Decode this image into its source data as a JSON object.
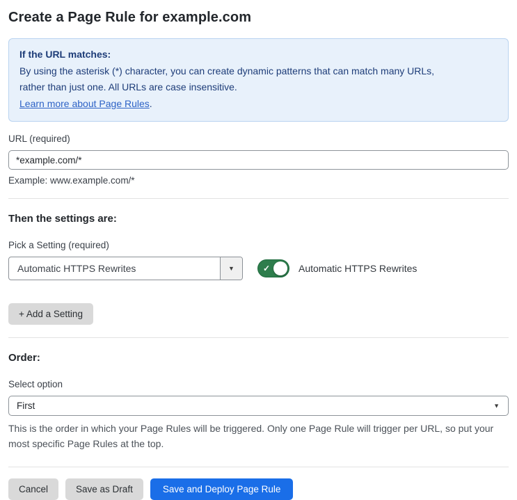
{
  "page": {
    "title": "Create a Page Rule for example.com"
  },
  "info_box": {
    "heading": "If the URL matches:",
    "body_line1": "By using the asterisk (*) character, you can create dynamic patterns that can match many URLs,",
    "body_line2": "rather than just one. All URLs are case insensitive.",
    "link_label": "Learn more about Page Rules",
    "link_suffix": "."
  },
  "url_field": {
    "label": "URL (required)",
    "value": "*example.com/*",
    "helper": "Example: www.example.com/*"
  },
  "settings_section": {
    "heading": "Then the settings are:",
    "picker_label": "Pick a Setting (required)",
    "picker_value": "Automatic HTTPS Rewrites",
    "toggle_state": "on",
    "toggle_label": "Automatic HTTPS Rewrites",
    "add_button_label": "+ Add a Setting"
  },
  "order_section": {
    "heading": "Order:",
    "select_label": "Select option",
    "select_value": "First",
    "helper": "This is the order in which your Page Rules will be triggered. Only one Page Rule will trigger per URL, so put your most specific Page Rules at the top."
  },
  "footer": {
    "cancel_label": "Cancel",
    "save_draft_label": "Save as Draft",
    "deploy_label": "Save and Deploy Page Rule"
  },
  "icons": {
    "caret_down": "▼",
    "toggle_check": "✓"
  },
  "colors": {
    "info_bg": "#e8f1fb",
    "info_border": "#b9d3f0",
    "info_text": "#1d3c78",
    "link_blue": "#2d62c6",
    "toggle_green": "#2e7d4c",
    "primary_blue": "#1a6ee8",
    "button_gray": "#d9d9d9"
  }
}
